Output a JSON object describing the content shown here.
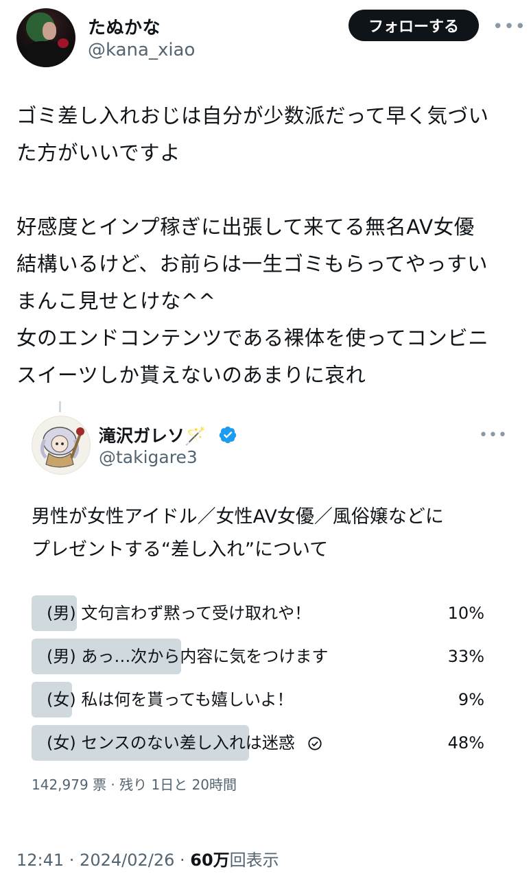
{
  "author": {
    "display_name": "たぬかな",
    "handle": "@kana_xiao",
    "follow_label": "フォローする",
    "more_label": "•••"
  },
  "tweet": {
    "text": "ゴミ差し入れおじは自分が少数派だって早く気づい\nた方がいいですよ\n\n好感度とインプ稼ぎに出張して来てる無名AV女優\n結構いるけど、お前らは一生ゴミもらってやっすい\nまんこ見せとけな^^\n女のエンドコンテンツである裸体を使ってコンビニ\nスイーツしか貰えないのあまりに哀れ"
  },
  "quoted": {
    "display_name": "滝沢ガレソ🪄",
    "handle": "@takigare3",
    "more_label": "•••",
    "text": "男性が女性アイドル／女性AV女優／風俗嬢などに\nプレゼントする“差し入れ”について",
    "poll": {
      "options": [
        {
          "label": "(男) 文句言わず黙って受け取れや！",
          "percent": 10,
          "percent_text": "10%",
          "selected": false
        },
        {
          "label": "(男) あっ…次から内容に気をつけます",
          "percent": 33,
          "percent_text": "33%",
          "selected": false
        },
        {
          "label": "(女) 私は何を貰っても嬉しいよ！",
          "percent": 9,
          "percent_text": "9%",
          "selected": false
        },
        {
          "label": "(女) センスのない差し入れは迷惑",
          "percent": 48,
          "percent_text": "48%",
          "selected": true
        }
      ],
      "meta": "142,979 票 · 残り 1日と 20時間"
    }
  },
  "footer": {
    "time": "12:41 · 2024/02/26 · ",
    "views_count": "60万",
    "views_suffix": "回表示"
  }
}
